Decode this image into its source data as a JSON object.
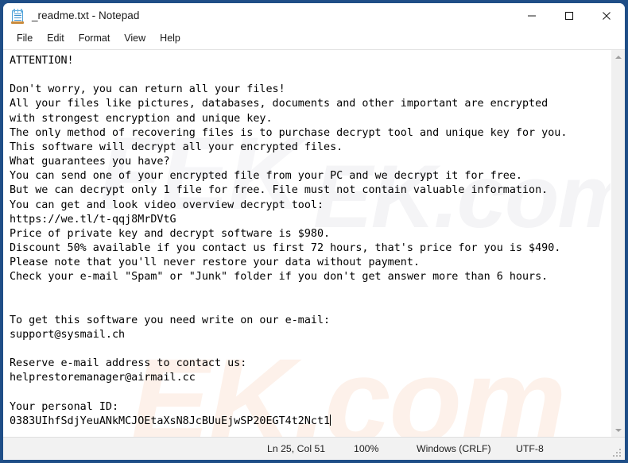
{
  "window": {
    "title": "_readme.txt - Notepad",
    "icon": "notepad-icon",
    "controls": {
      "minimize": "Minimize",
      "maximize": "Maximize",
      "close": "Close"
    },
    "border_color": "#1f4e87"
  },
  "menu": {
    "items": [
      {
        "label": "File"
      },
      {
        "label": "Edit"
      },
      {
        "label": "Format"
      },
      {
        "label": "View"
      },
      {
        "label": "Help"
      }
    ]
  },
  "document": {
    "lines": [
      "ATTENTION!",
      "",
      "Don't worry, you can return all your files!",
      "All your files like pictures, databases, documents and other important are encrypted",
      "with strongest encryption and unique key.",
      "The only method of recovering files is to purchase decrypt tool and unique key for you.",
      "This software will decrypt all your encrypted files.",
      "What guarantees you have?",
      "You can send one of your encrypted file from your PC and we decrypt it for free.",
      "But we can decrypt only 1 file for free. File must not contain valuable information.",
      "You can get and look video overview decrypt tool:",
      "https://we.tl/t-qqj8MrDVtG",
      "Price of private key and decrypt software is $980.",
      "Discount 50% available if you contact us first 72 hours, that's price for you is $490.",
      "Please note that you'll never restore your data without payment.",
      "Check your e-mail \"Spam\" or \"Junk\" folder if you don't get answer more than 6 hours.",
      "",
      "",
      "To get this software you need write on our e-mail:",
      "support@sysmail.ch",
      "",
      "Reserve e-mail address to contact us:",
      "helprestoremanager@airmail.cc",
      "",
      "Your personal ID:",
      "0383UIhfSdjYeuANkMCJOEtaXsN8JcBUuEjwSP20EGT4t2Nct1"
    ],
    "watermark_text": "FEK.com"
  },
  "scrollbar": {
    "up_arrow": "scroll-up-arrow",
    "down_arrow": "scroll-down-arrow"
  },
  "statusbar": {
    "position": "Ln 25, Col 51",
    "zoom": "100%",
    "line_ending": "Windows (CRLF)",
    "encoding": "UTF-8"
  }
}
